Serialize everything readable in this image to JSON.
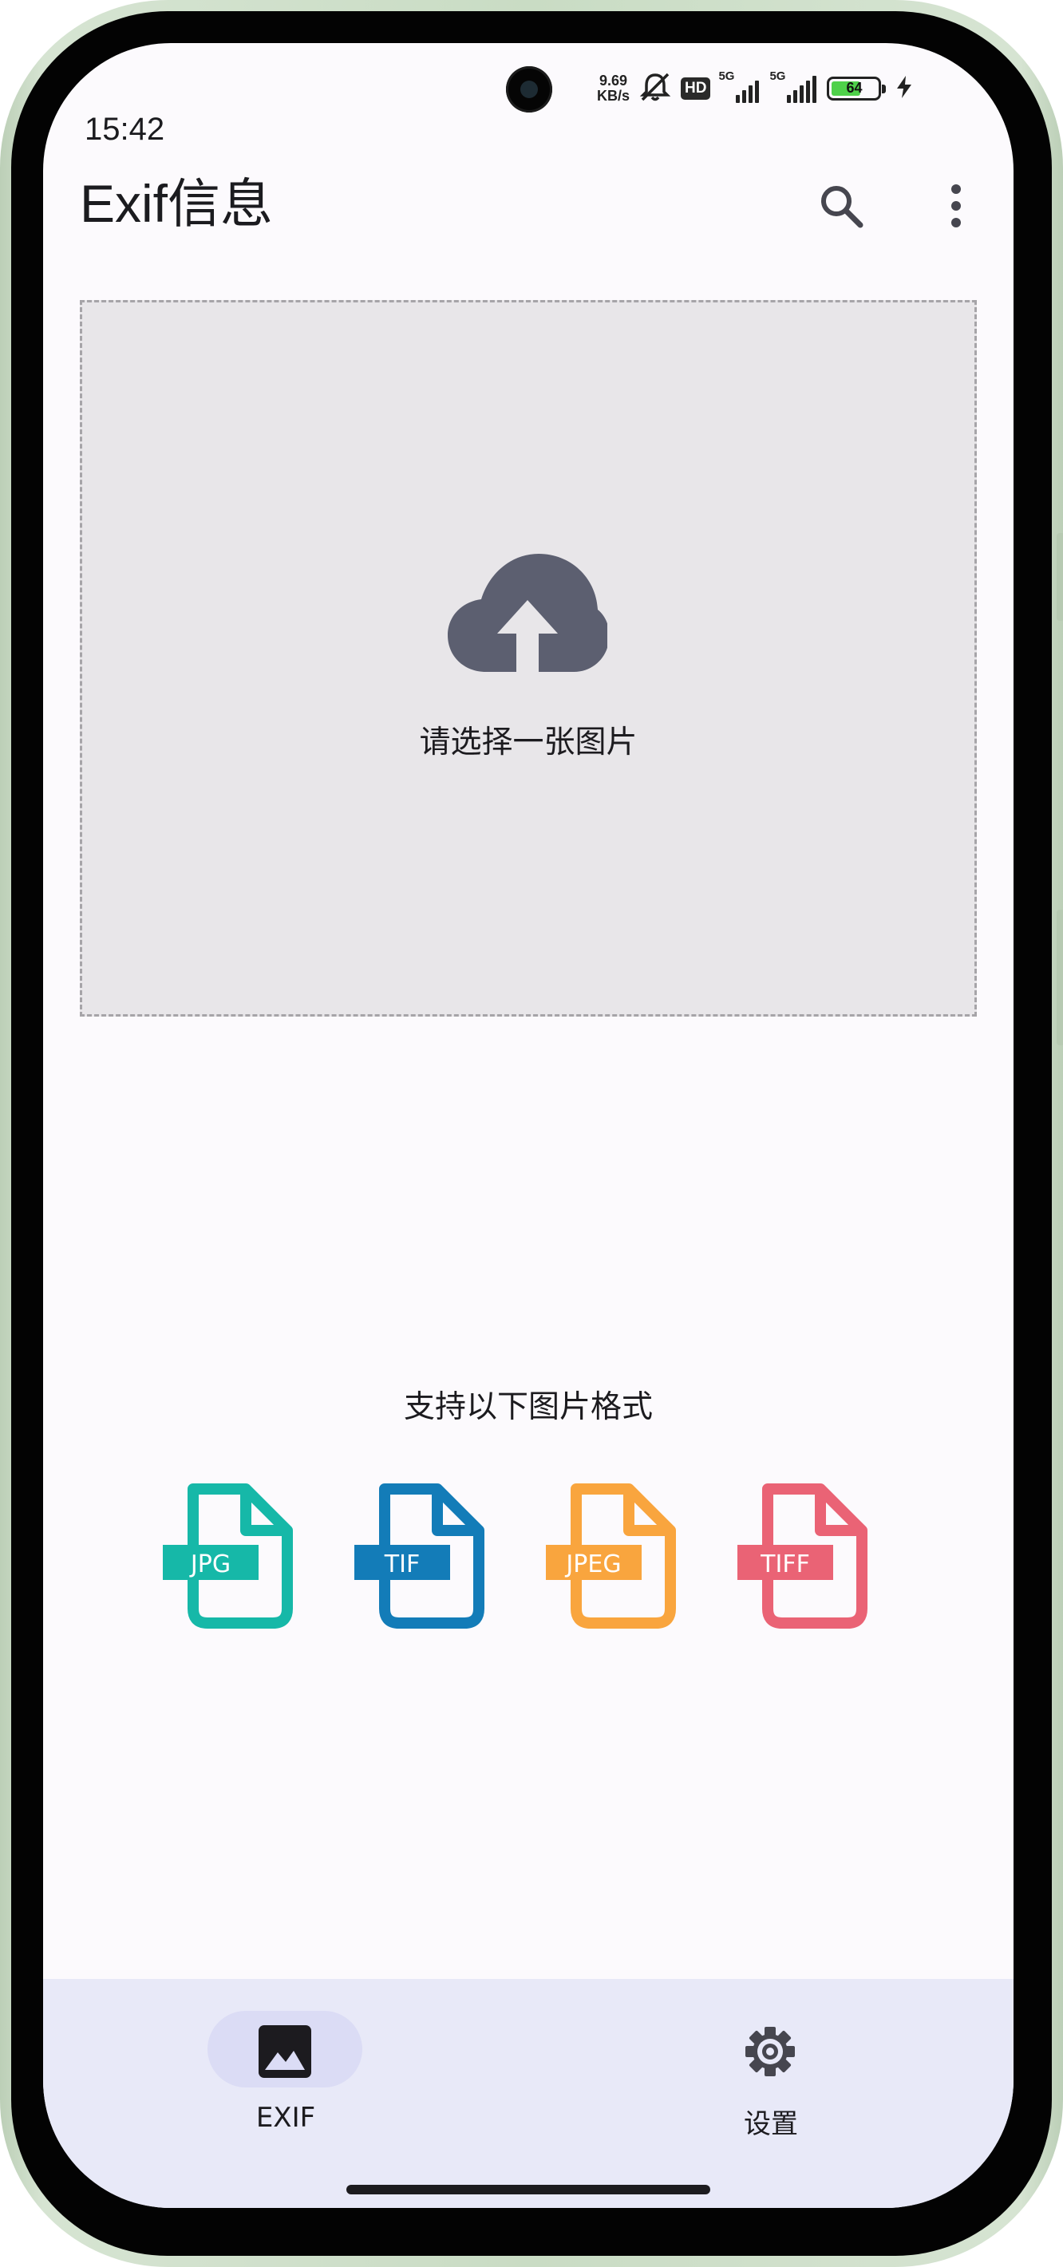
{
  "status_bar": {
    "time": "15:42",
    "net_speed_value": "9.69",
    "net_speed_unit": "KB/s",
    "hd_badge": "HD",
    "network_1": "5G",
    "network_2": "5G",
    "battery_level": "64",
    "battery_color": "#4fd14a"
  },
  "app_bar": {
    "title": "Exif信息",
    "search_icon": "search-icon",
    "more_icon": "more-vert-icon"
  },
  "upload": {
    "prompt": "请选择一张图片",
    "icon": "cloud-upload-icon",
    "icon_color": "#5c5f70"
  },
  "formats": {
    "title": "支持以下图片格式",
    "items": [
      {
        "label": "JPG",
        "color": "#16b8a8"
      },
      {
        "label": "TIF",
        "color": "#137cb8"
      },
      {
        "label": "JPEG",
        "color": "#f9a53e"
      },
      {
        "label": "TIFF",
        "color": "#ea6375"
      }
    ]
  },
  "bottom_nav": {
    "items": [
      {
        "label": "EXIF",
        "icon": "image-icon",
        "selected": true
      },
      {
        "label": "设置",
        "icon": "gear-icon",
        "selected": false
      }
    ]
  }
}
